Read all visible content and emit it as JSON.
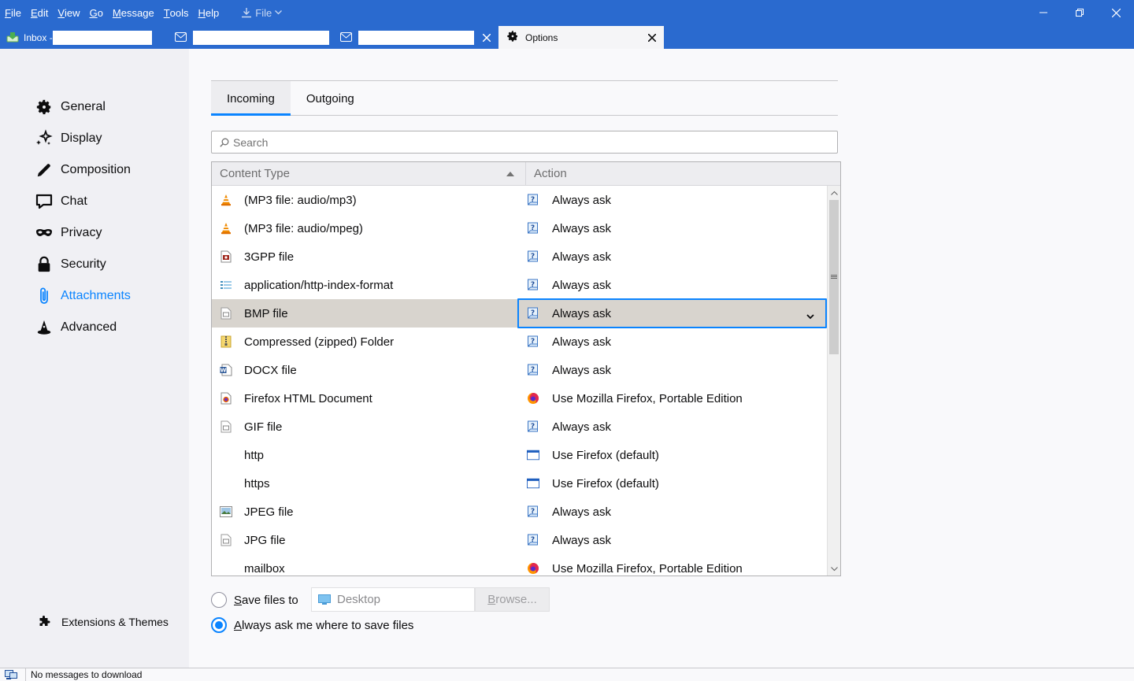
{
  "menubar": {
    "items": [
      {
        "label": "File",
        "accel": "F",
        "rest": "ile"
      },
      {
        "label": "Edit",
        "accel": "E",
        "rest": "dit"
      },
      {
        "label": "View",
        "accel": "V",
        "rest": "iew"
      },
      {
        "label": "Go",
        "accel": "G",
        "rest": "o"
      },
      {
        "label": "Message",
        "accel": "M",
        "rest": "essage"
      },
      {
        "label": "Tools",
        "accel": "T",
        "rest": "ools"
      },
      {
        "label": "Help",
        "accel": "H",
        "rest": "elp"
      }
    ],
    "file_download_label": "File"
  },
  "tabs": {
    "inbox_label": "Inbox -",
    "options_label": "Options"
  },
  "sidebar": {
    "categories": [
      {
        "label": "General",
        "icon": "gear-icon"
      },
      {
        "label": "Display",
        "icon": "display-sparkle-icon"
      },
      {
        "label": "Composition",
        "icon": "pencil-icon"
      },
      {
        "label": "Chat",
        "icon": "chat-bubble-icon"
      },
      {
        "label": "Privacy",
        "icon": "mask-icon"
      },
      {
        "label": "Security",
        "icon": "lock-icon"
      },
      {
        "label": "Attachments",
        "icon": "paperclip-icon",
        "selected": true
      },
      {
        "label": "Advanced",
        "icon": "wizard-hat-icon"
      }
    ],
    "extensions_label": "Extensions & Themes"
  },
  "subtabs": {
    "incoming": "Incoming",
    "outgoing": "Outgoing"
  },
  "search": {
    "placeholder": "Search"
  },
  "table": {
    "headers": {
      "content_type": "Content Type",
      "action": "Action"
    },
    "rows": [
      {
        "type": "(MP3 file: audio/mp3)",
        "type_icon": "vlc-cone-icon",
        "action": "Always ask",
        "action_icon": "ask-icon"
      },
      {
        "type": "(MP3 file: audio/mpeg)",
        "type_icon": "vlc-cone-icon",
        "action": "Always ask",
        "action_icon": "ask-icon"
      },
      {
        "type": "3GPP file",
        "type_icon": "video-file-icon",
        "action": "Always ask",
        "action_icon": "ask-icon"
      },
      {
        "type": "application/http-index-format",
        "type_icon": "index-file-icon",
        "action": "Always ask",
        "action_icon": "ask-icon"
      },
      {
        "type": "BMP file",
        "type_icon": "image-file-icon",
        "action": "Always ask",
        "action_icon": "ask-icon",
        "selected": true
      },
      {
        "type": "Compressed (zipped) Folder",
        "type_icon": "zip-folder-icon",
        "action": "Always ask",
        "action_icon": "ask-icon"
      },
      {
        "type": "DOCX file",
        "type_icon": "word-doc-icon",
        "action": "Always ask",
        "action_icon": "ask-icon"
      },
      {
        "type": "Firefox HTML Document",
        "type_icon": "firefox-doc-icon",
        "action": "Use Mozilla Firefox, Portable Edition",
        "action_icon": "firefox-icon"
      },
      {
        "type": "GIF file",
        "type_icon": "image-file-icon",
        "action": "Always ask",
        "action_icon": "ask-icon"
      },
      {
        "type": "http",
        "type_icon": "",
        "action": "Use Firefox (default)",
        "action_icon": "browser-window-icon"
      },
      {
        "type": "https",
        "type_icon": "",
        "action": "Use Firefox (default)",
        "action_icon": "browser-window-icon"
      },
      {
        "type": "JPEG file",
        "type_icon": "photo-file-icon",
        "action": "Always ask",
        "action_icon": "ask-icon"
      },
      {
        "type": "JPG file",
        "type_icon": "image-file-icon",
        "action": "Always ask",
        "action_icon": "ask-icon"
      },
      {
        "type": "mailbox",
        "type_icon": "",
        "action": "Use Mozilla Firefox, Portable Edition",
        "action_icon": "firefox-icon"
      }
    ]
  },
  "save": {
    "save_files_label_accel": "S",
    "save_files_label_rest": "ave files to",
    "folder_value": "Desktop",
    "browse_accel": "B",
    "browse_rest": "rowse...",
    "always_ask_accel": "A",
    "always_ask_rest": "lways ask me where to save files",
    "selected_option": "always_ask"
  },
  "status": {
    "text": "No messages to download"
  },
  "colors": {
    "titlebar": "#2a6acf",
    "accent": "#0a84ff",
    "selected_row": "#d8d4ce"
  }
}
